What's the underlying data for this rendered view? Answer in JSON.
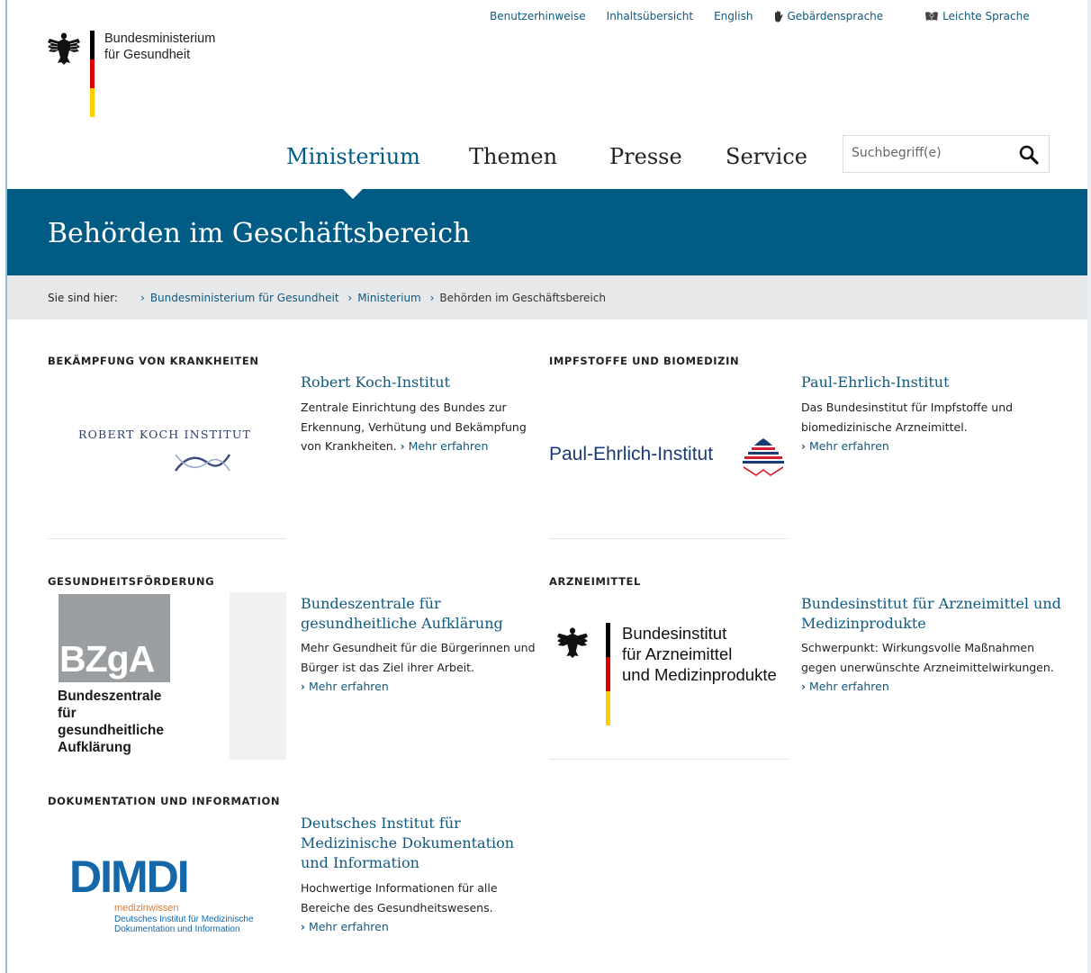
{
  "header": {
    "logo_line1": "Bundesministerium",
    "logo_line2": "für Gesundheit",
    "service_links": [
      {
        "label": "Benutzerhinweise"
      },
      {
        "label": "Inhaltsübersicht"
      },
      {
        "label": "English"
      },
      {
        "label": "Gebärdensprache",
        "icon": "hand-icon"
      },
      {
        "label": "Leichte Sprache",
        "icon": "easy-language-icon"
      }
    ],
    "nav": [
      "Ministerium",
      "Themen",
      "Presse",
      "Service"
    ],
    "active_nav": "Ministerium",
    "search_placeholder": "Suchbegriff(e)"
  },
  "hero": {
    "title": "Behörden im Geschäftsbereich"
  },
  "breadcrumb": {
    "label": "Sie sind hier:",
    "items": [
      "Bundesministerium für Gesundheit",
      "Ministerium"
    ],
    "current": "Behörden im Geschäftsbereich",
    "separator": "›"
  },
  "sections": [
    {
      "heading": "BEKÄMPFUNG VON KRANKHEITEN",
      "logo_text": "ROBERT KOCH INSTITUT",
      "title": "Robert Koch-Institut",
      "desc": "Zentrale Einrichtung des Bundes zur Erkennung, Verhütung und Bekämpfung von Krankheiten.",
      "more": "Mehr erfahren"
    },
    {
      "heading": "IMPFSTOFFE UND BIOMEDIZIN",
      "logo_text": "Paul-Ehrlich-Institut",
      "title": "Paul-Ehrlich-Institut",
      "desc": "Das Bundesinstitut für Impfstoffe und biomedizinische Arzneimittel.",
      "more": "Mehr erfahren"
    },
    {
      "heading": "GESUNDHEITSFÖRDERUNG",
      "logo_text": "BZgA",
      "logo_sub": [
        "Bundeszentrale",
        "für",
        "gesundheitliche",
        "Aufklärung"
      ],
      "title": "Bundeszentrale für gesundheitliche Aufklärung",
      "desc": "Mehr Gesundheit für die Bürgerinnen und Bürger ist das Ziel ihrer Arbeit.",
      "more": "Mehr erfahren"
    },
    {
      "heading": "ARZNEIMITTEL",
      "logo_sub": [
        "Bundesinstitut",
        "für Arzneimittel",
        "und Medizinprodukte"
      ],
      "title": "Bundesinstitut für Arzneimittel und Medizinprodukte",
      "desc": "Schwerpunkt: Wirkungsvolle Maßnahmen gegen unerwünschte Arzneimittelwirkungen.",
      "more": "Mehr erfahren"
    },
    {
      "heading": "DOKUMENTATION UND INFORMATION",
      "logo_text": "DIMDI",
      "logo_tag": "medizinwissen",
      "logo_sub": [
        "Deutsches Institut für Medizinische",
        "Dokumentation und Information"
      ],
      "title": "Deutsches Institut für Medizinische Dokumentation und Information",
      "desc": "Hochwertige Informationen für alle Bereiche des Gesundheitswesens.",
      "more": "Mehr erfahren"
    }
  ],
  "colors": {
    "brand": "#005c85",
    "link": "#10597f",
    "breadcrumb_bg": "#e6e8ea",
    "flag_black": "#000000",
    "flag_red": "#dd0000",
    "flag_gold": "#ffce00"
  }
}
